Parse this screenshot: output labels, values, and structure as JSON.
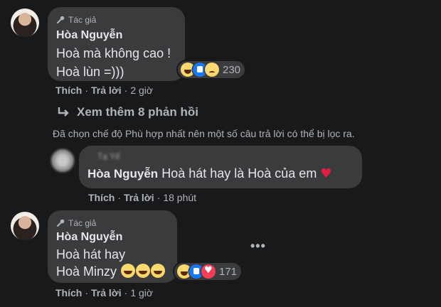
{
  "comments": [
    {
      "author_tag": "Tác giả",
      "name": "Hòa Nguyễn",
      "lines": [
        "Hoà mà không cao !",
        "Hoà lùn =)))"
      ],
      "reaction_icons": [
        "haha-reaction-icon",
        "like-reaction-icon",
        "sad-reaction-icon"
      ],
      "reaction_count": "230",
      "action_like": "Thích",
      "action_reply": "Trả lời",
      "time": "2 giờ"
    },
    {
      "author_tag": "Tác giả",
      "name": "Hòa Nguyễn",
      "lines": [
        "Hoà hát hay",
        "Hoà Minzy"
      ],
      "reaction_icons": [
        "haha-reaction-icon",
        "like-reaction-icon",
        "love-reaction-icon"
      ],
      "reaction_count": "171",
      "action_like": "Thích",
      "action_reply": "Trả lời",
      "time": "1 giờ"
    }
  ],
  "view_more": "Xem thêm 8 phản hồi",
  "filter_note": "Đã chọn chế độ Phù hợp nhất nên một số câu trả lời có thể bị lọc ra.",
  "reply": {
    "blurred_name": "Tạ Yế",
    "mention": "Hòa Nguyễn",
    "text": " Hoà hát hay là Hoà của em ",
    "action_like": "Thích",
    "action_reply": "Trả lời",
    "time": "18 phút"
  },
  "separator": " · ",
  "colors": {
    "background": "#18191a",
    "bubble": "#3a3b3c",
    "text": "#e4e6eb",
    "muted": "#b0b3b8",
    "like": "#1877f2",
    "love": "#f33e58",
    "heart": "#e41e3f"
  }
}
